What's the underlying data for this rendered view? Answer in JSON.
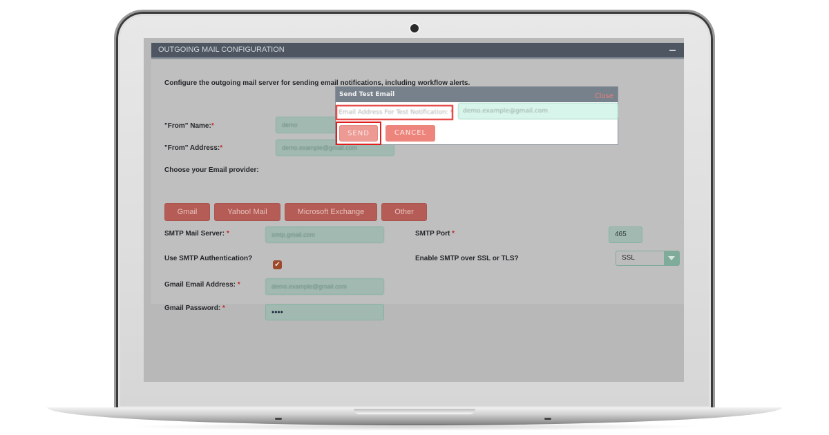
{
  "panel": {
    "title": "OUTGOING MAIL CONFIGURATION",
    "description": "Configure the outgoing mail server for sending email notifications, including workflow alerts."
  },
  "form": {
    "from_name": {
      "label": "\"From\" Name:",
      "required": "*",
      "value": "demo"
    },
    "from_address": {
      "label": "\"From\" Address:",
      "required": "*",
      "value": "demo.example@gmail.com"
    },
    "provider_label": "Choose your Email provider:",
    "providers": [
      "Gmail",
      "Yahoo! Mail",
      "Microsoft Exchange",
      "Other"
    ],
    "smtp_server": {
      "label": "SMTP Mail Server:",
      "required": "*",
      "value": "smtp.gmail.com"
    },
    "smtp_port": {
      "label": "SMTP Port",
      "required": "*",
      "value": "465"
    },
    "smtp_auth": {
      "label": "Use SMTP Authentication?",
      "checked": true,
      "check_glyph": "✔"
    },
    "ssl_tls": {
      "label": "Enable SMTP over SSL or TLS?",
      "selected": "SSL"
    },
    "gmail_address": {
      "label": "Gmail Email Address:",
      "required": "*",
      "value": "demo.example@gmail.com"
    },
    "gmail_password": {
      "label": "Gmail Password:",
      "required": "*",
      "value": "••••"
    }
  },
  "dialog": {
    "title": "Send Test Email",
    "close_label": "Close",
    "field_label": "Email Address For Test Notification:",
    "field_required": "*",
    "field_value": "demo.example@gmail.com",
    "send_label": "SEND",
    "cancel_label": "CANCEL"
  },
  "colors": {
    "header_bg": "#4d5661",
    "provider_button": "#b45c55",
    "input_bg": "#a2b9b1",
    "highlight_box": "#e01e1e",
    "send_button": "#ec9a93",
    "cancel_button": "#ee857d"
  }
}
